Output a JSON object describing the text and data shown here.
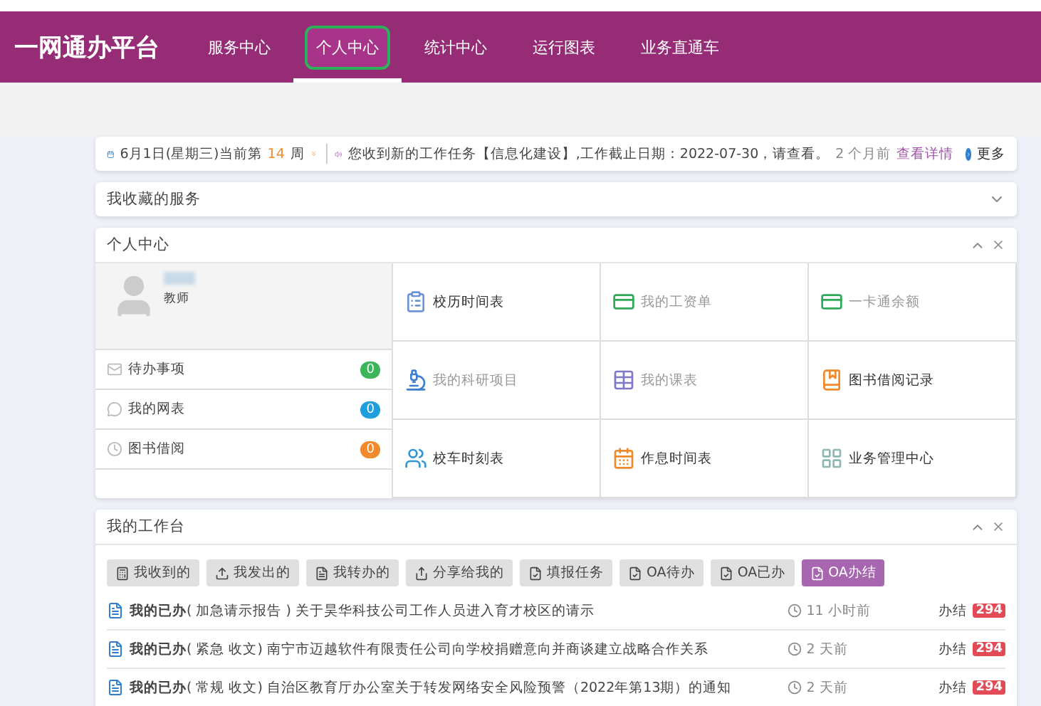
{
  "header": {
    "logo": "一网通办平台",
    "tabs": [
      {
        "label": "服务中心",
        "selected": false
      },
      {
        "label": "个人中心",
        "selected": true
      },
      {
        "label": "统计中心",
        "selected": false
      },
      {
        "label": "运行图表",
        "selected": false
      },
      {
        "label": "业务直通车",
        "selected": false
      }
    ]
  },
  "notice": {
    "date": "6月1日(星期三)当前第",
    "week": "14",
    "week_unit": "周",
    "message": "您收到新的工作任务【信息化建设】,工作截止日期：2022-07-30，请查看。",
    "time": "2 个月前",
    "link": "查看详情",
    "more": "更多"
  },
  "favorites": {
    "title": "我收藏的服务",
    "expanded": false
  },
  "personal": {
    "title": "个人中心",
    "role": "教师",
    "counters": [
      {
        "label": "待办事项",
        "count": "0",
        "color": "#3bb55a"
      },
      {
        "label": "我的网表",
        "count": "0",
        "color": "#1e9fdc"
      },
      {
        "label": "图书借阅",
        "count": "0",
        "color": "#f08a2a"
      }
    ],
    "shortcuts": [
      {
        "label": "校历时间表",
        "color": "#6d94d8",
        "disabled": false
      },
      {
        "label": "我的工资单",
        "color": "#2eaa57",
        "disabled": true
      },
      {
        "label": "一卡通余额",
        "color": "#2eaa57",
        "disabled": true
      },
      {
        "label": "我的科研项目",
        "color": "#3d7fd0",
        "disabled": true
      },
      {
        "label": "我的课表",
        "color": "#7f78c8",
        "disabled": true
      },
      {
        "label": "图书借阅记录",
        "color": "#f08a2a",
        "disabled": false
      },
      {
        "label": "校车时刻表",
        "color": "#2f96d8",
        "disabled": false
      },
      {
        "label": "作息时间表",
        "color": "#f08a2a",
        "disabled": false
      },
      {
        "label": "业务管理中心",
        "color": "#8fb8b0",
        "disabled": false
      }
    ]
  },
  "workbench": {
    "title": "我的工作台",
    "tabs": [
      {
        "label": "我收到的",
        "selected": false
      },
      {
        "label": "我发出的",
        "selected": false
      },
      {
        "label": "我转办的",
        "selected": false
      },
      {
        "label": "分享给我的",
        "selected": false
      },
      {
        "label": "填报任务",
        "selected": false
      },
      {
        "label": "OA待办",
        "selected": false
      },
      {
        "label": "OA已办",
        "selected": false
      },
      {
        "label": "OA办结",
        "selected": true
      }
    ],
    "rows": [
      {
        "text": "**我的已办**( 加急请示报告 ) 关于昊华科技公司工作人员进入育才校区的请示",
        "time": "11 小时前",
        "status": "办结",
        "count": "294"
      },
      {
        "text": "**我的已办**( 紧急 收文) 南宁市迈越软件有限责任公司向学校捐赠意向并商谈建立战略合作关系",
        "time": "2 天前",
        "status": "办结",
        "count": "294"
      },
      {
        "text": "**我的已办**( 常规 收文) 自治区教育厅办公室关于转发网络安全风险预警（2022年第13期）的通知",
        "time": "2 天前",
        "status": "办结",
        "count": "294"
      }
    ]
  }
}
